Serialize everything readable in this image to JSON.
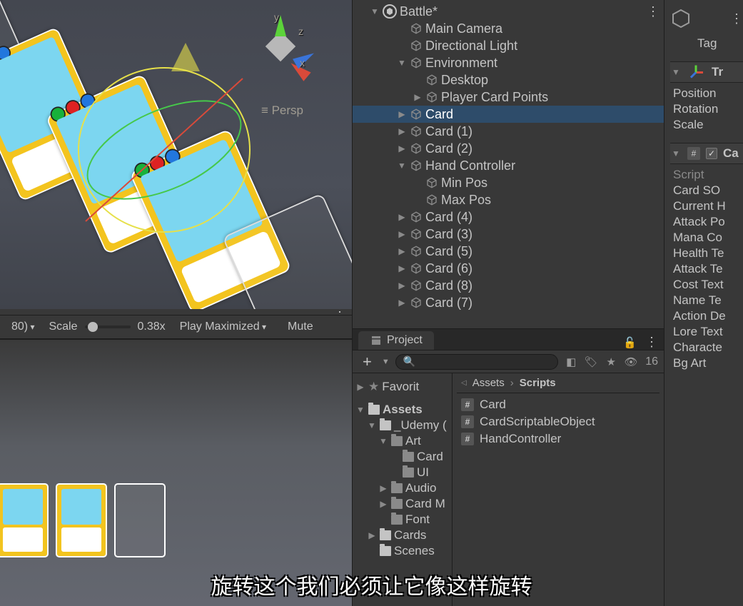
{
  "scene_view": {
    "projection_label": "≡ Persp",
    "axis_labels": {
      "x": "x",
      "y": "y",
      "z": "z"
    }
  },
  "game_toolbar": {
    "aspect_suffix": "80)",
    "scale_label": "Scale",
    "scale_value": "0.38x",
    "play_mode": "Play Maximized",
    "mute_label": "Mute"
  },
  "hierarchy": {
    "scene_name": "Battle*",
    "items": [
      {
        "depth": 1,
        "arrow": null,
        "label": "Main Camera"
      },
      {
        "depth": 1,
        "arrow": null,
        "label": "Directional Light"
      },
      {
        "depth": 1,
        "arrow": "▼",
        "label": "Environment"
      },
      {
        "depth": 2,
        "arrow": null,
        "label": "Desktop"
      },
      {
        "depth": 2,
        "arrow": "▶",
        "label": "Player Card Points"
      },
      {
        "depth": 1,
        "arrow": "▶",
        "label": "Card",
        "selected": true
      },
      {
        "depth": 1,
        "arrow": "▶",
        "label": "Card (1)"
      },
      {
        "depth": 1,
        "arrow": "▶",
        "label": "Card (2)"
      },
      {
        "depth": 1,
        "arrow": "▼",
        "label": "Hand Controller"
      },
      {
        "depth": 2,
        "arrow": null,
        "label": "Min Pos"
      },
      {
        "depth": 2,
        "arrow": null,
        "label": "Max Pos"
      },
      {
        "depth": 1,
        "arrow": "▶",
        "label": "Card (4)"
      },
      {
        "depth": 1,
        "arrow": "▶",
        "label": "Card (3)"
      },
      {
        "depth": 1,
        "arrow": "▶",
        "label": "Card (5)"
      },
      {
        "depth": 1,
        "arrow": "▶",
        "label": "Card (6)"
      },
      {
        "depth": 1,
        "arrow": "▶",
        "label": "Card (8)"
      },
      {
        "depth": 1,
        "arrow": "▶",
        "label": "Card (7)"
      }
    ]
  },
  "project": {
    "tab_label": "Project",
    "count_label": "16",
    "search_placeholder": "",
    "breadcrumb": {
      "root": "Assets",
      "current": "Scripts"
    },
    "favorites_label": "Favorit",
    "folders": [
      {
        "depth": 0,
        "arrow": "▼",
        "label": "Assets",
        "bold": true
      },
      {
        "depth": 1,
        "arrow": "▼",
        "label": "_Udemy ("
      },
      {
        "depth": 2,
        "arrow": "▼",
        "label": "Art"
      },
      {
        "depth": 3,
        "arrow": null,
        "label": "Card"
      },
      {
        "depth": 3,
        "arrow": null,
        "label": "UI"
      },
      {
        "depth": 2,
        "arrow": "▶",
        "label": "Audio"
      },
      {
        "depth": 2,
        "arrow": "▶",
        "label": "Card M"
      },
      {
        "depth": 2,
        "arrow": null,
        "label": "Font"
      },
      {
        "depth": 1,
        "arrow": "▶",
        "label": "Cards"
      },
      {
        "depth": 1,
        "arrow": null,
        "label": "Scenes"
      }
    ],
    "assets": [
      {
        "label": "Card"
      },
      {
        "label": "CardScriptableObject"
      },
      {
        "label": "HandController"
      }
    ]
  },
  "inspector": {
    "tag_label": "Tag",
    "transform": {
      "header": "Tr",
      "fields": [
        "Position",
        "Rotation",
        "Scale"
      ]
    },
    "component": {
      "enabled": true,
      "header": "Ca",
      "fields": [
        {
          "label": "Script",
          "dim": true
        },
        {
          "label": "Card SO"
        },
        {
          "label": "Current H"
        },
        {
          "label": "Attack Po"
        },
        {
          "label": "Mana Co"
        },
        {
          "label": "Health Te"
        },
        {
          "label": "Attack Te"
        },
        {
          "label": "Cost Text"
        },
        {
          "label": "Name Te"
        },
        {
          "label": "Action De"
        },
        {
          "label": "Lore Text"
        },
        {
          "label": "Characte"
        },
        {
          "label": "Bg Art"
        }
      ]
    }
  },
  "subtitle": "旋转这个我们必须让它像这样旋转"
}
